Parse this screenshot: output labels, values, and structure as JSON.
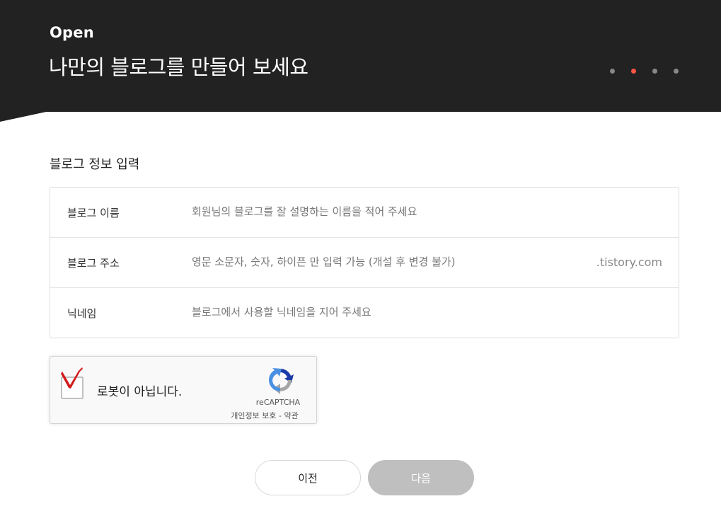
{
  "header": {
    "eyebrow": "Open",
    "title": "나만의 블로그를 만들어 보세요",
    "steps": {
      "total": 4,
      "current": 2
    },
    "colors": {
      "background": "#222222",
      "active_step": "#ff5544",
      "inactive_step": "#888888"
    }
  },
  "section": {
    "title": "블로그 정보 입력"
  },
  "form": {
    "rows": [
      {
        "label": "블로그 이름",
        "value": "",
        "placeholder": "회원님의 블로그를 잘 설명하는 이름을 적어 주세요",
        "suffix": ""
      },
      {
        "label": "블로그 주소",
        "value": "",
        "placeholder": "영문 소문자, 숫자, 하이픈 만 입력 가능 (개설 후 변경 불가)",
        "suffix": ".tistory.com"
      },
      {
        "label": "닉네임",
        "value": "",
        "placeholder": "블로그에서 사용할 닉네임을 지어 주세요",
        "suffix": ""
      }
    ]
  },
  "recaptcha": {
    "label": "로봇이 아닙니다.",
    "checked_mark_color": "#dd1111",
    "brand": "reCAPTCHA",
    "privacy_label": "개인정보 보호",
    "separator": " - ",
    "terms_label": "약관",
    "icon": "recaptcha-logo-icon"
  },
  "buttons": {
    "prev_label": "이전",
    "next_label": "다음",
    "next_disabled_color": "#bfbfbf"
  }
}
